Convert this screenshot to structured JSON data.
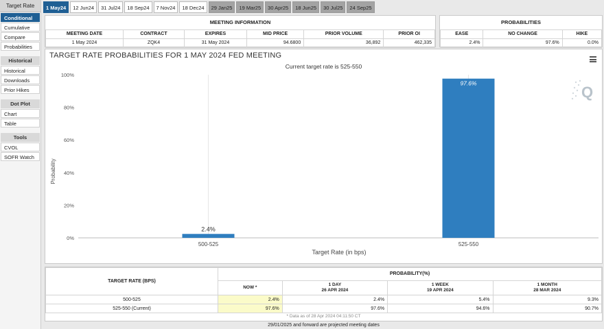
{
  "sidebar": {
    "title": "Target Rate",
    "top_items": [
      "Conditional",
      "Cumulative",
      "Compare",
      "Probabilities"
    ],
    "sections": [
      {
        "heading": "Historical",
        "items": [
          "Historical",
          "Downloads",
          "Prior Hikes"
        ]
      },
      {
        "heading": "Dot Plot",
        "items": [
          "Chart",
          "Table"
        ]
      },
      {
        "heading": "Tools",
        "items": [
          "CVOL",
          "SOFR Watch"
        ]
      }
    ]
  },
  "tabs": [
    "1 May24",
    "12 Jun24",
    "31 Jul24",
    "18 Sep24",
    "7 Nov24",
    "18 Dec24",
    "29 Jan25",
    "19 Mar25",
    "30 Apr25",
    "18 Jun25",
    "30 Jul25",
    "24 Sep25"
  ],
  "meeting": {
    "title": "MEETING INFORMATION",
    "headers": [
      "MEETING DATE",
      "CONTRACT",
      "EXPIRES",
      "MID PRICE",
      "PRIOR VOLUME",
      "PRIOR OI"
    ],
    "row": [
      "1 May 2024",
      "ZQK4",
      "31 May 2024",
      "94.6800",
      "36,892",
      "462,335"
    ]
  },
  "probabilities": {
    "title": "PROBABILITIES",
    "headers": [
      "EASE",
      "NO CHANGE",
      "HIKE"
    ],
    "row": [
      "2.4%",
      "97.6%",
      "0.0%"
    ]
  },
  "chart": {
    "title": "TARGET RATE PROBABILITIES FOR 1 MAY 2024 FED MEETING",
    "subtitle": "Current target rate is 525-550",
    "menu_icon": "hamburger-menu-icon",
    "watermark_icon": "cme-q-logo-icon",
    "bar_color": "#2f7ebf"
  },
  "chart_data": {
    "type": "bar",
    "categories": [
      "500-525",
      "525-550"
    ],
    "values": [
      2.4,
      97.6
    ],
    "data_labels": [
      "2.4%",
      "97.6%"
    ],
    "xlabel": "Target Rate (in bps)",
    "ylabel": "Probability",
    "ylim": [
      0,
      100
    ],
    "yticks": [
      "0%",
      "20%",
      "40%",
      "60%",
      "80%",
      "100%"
    ],
    "grid": true
  },
  "prob_table": {
    "col0_header": "TARGET RATE (BPS)",
    "group_header": "PROBABILITY(%)",
    "sub_headers": [
      {
        "l1": "NOW *",
        "l2": ""
      },
      {
        "l1": "1 DAY",
        "l2": "26 APR 2024"
      },
      {
        "l1": "1 WEEK",
        "l2": "19 APR 2024"
      },
      {
        "l1": "1 MONTH",
        "l2": "28 MAR 2024"
      }
    ],
    "rows": [
      {
        "rate": "500-525",
        "vals": [
          "2.4%",
          "2.4%",
          "5.4%",
          "9.3%"
        ]
      },
      {
        "rate": "525-550 (Current)",
        "vals": [
          "97.6%",
          "97.6%",
          "94.6%",
          "90.7%"
        ]
      }
    ],
    "note": "* Data as of 28 Apr 2024 04:11:50 CT"
  },
  "footer": "29/01/2025 and forward are projected meeting dates"
}
